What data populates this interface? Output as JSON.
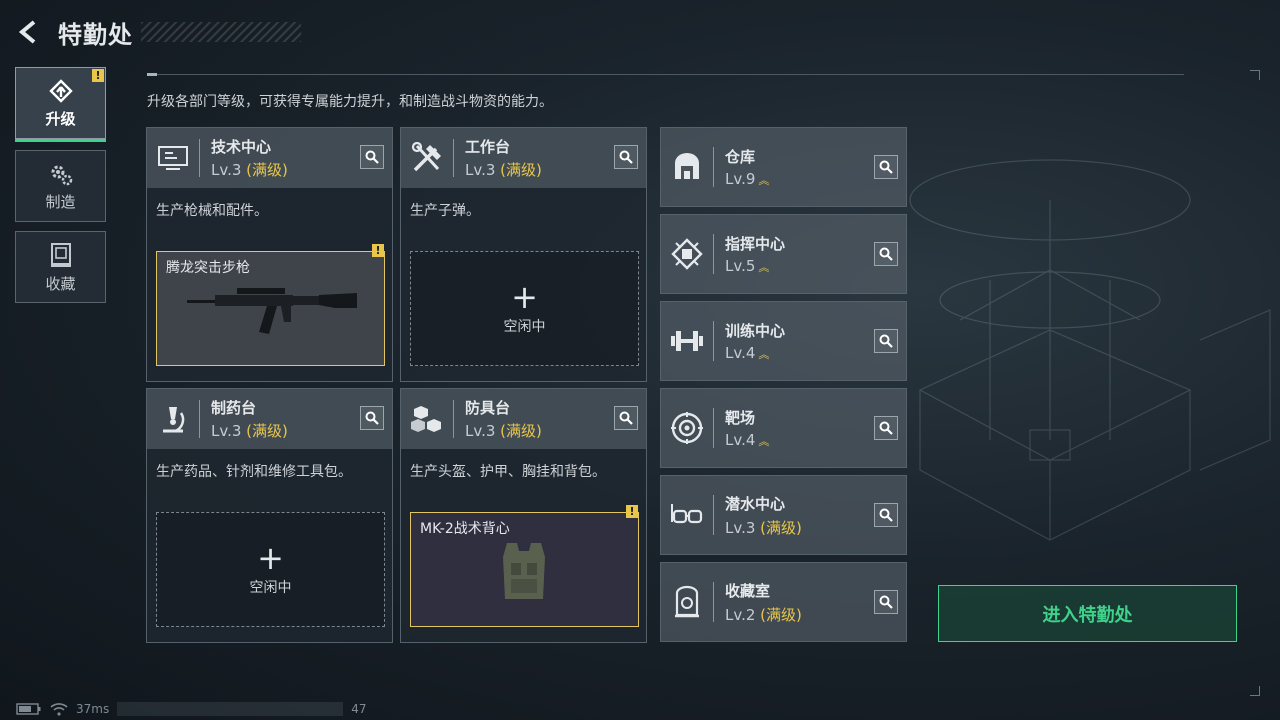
{
  "header": {
    "title": "特勤处"
  },
  "sidebar": {
    "items": [
      {
        "label": "升级",
        "icon": "upgrade-icon",
        "active": true,
        "alert": "!"
      },
      {
        "label": "制造",
        "icon": "gears-icon",
        "active": false
      },
      {
        "label": "收藏",
        "icon": "collection-icon",
        "active": false
      }
    ]
  },
  "description": "升级各部门等级，可获得专属能力提升，和制造战斗物资的能力。",
  "cards": [
    {
      "name": "技术中心",
      "level": "Lv.3",
      "status": "(满级)",
      "icon": "monitor-icon",
      "desc": "生产枪械和配件。",
      "slot": {
        "type": "item",
        "item_name": "腾龙突击步枪",
        "alert": "!",
        "image": "rifle-icon"
      }
    },
    {
      "name": "工作台",
      "level": "Lv.3",
      "status": "(满级)",
      "icon": "tools-icon",
      "desc": "生产子弹。",
      "slot": {
        "type": "idle",
        "plus": "+",
        "text": "空闲中"
      }
    },
    {
      "name": "制药台",
      "level": "Lv.3",
      "status": "(满级)",
      "icon": "microscope-icon",
      "desc": "生产药品、针剂和维修工具包。",
      "slot": {
        "type": "idle",
        "plus": "+",
        "text": "空闲中"
      }
    },
    {
      "name": "防具台",
      "level": "Lv.3",
      "status": "(满级)",
      "icon": "cubes-icon",
      "desc": "生产头盔、护甲、胸挂和背包。",
      "slot": {
        "type": "item",
        "item_name": "MK-2战术背心",
        "alert": "!",
        "image": "vest-icon"
      }
    }
  ],
  "facilities": [
    {
      "name": "仓库",
      "level": "Lv.9",
      "icon": "warehouse-icon",
      "upgradable": true
    },
    {
      "name": "指挥中心",
      "level": "Lv.5",
      "icon": "chip-icon",
      "upgradable": true
    },
    {
      "name": "训练中心",
      "level": "Lv.4",
      "icon": "dumbbell-icon",
      "upgradable": true
    },
    {
      "name": "靶场",
      "level": "Lv.4",
      "icon": "target-icon",
      "upgradable": true
    },
    {
      "name": "潜水中心",
      "level": "Lv.3",
      "status": "(满级)",
      "icon": "goggles-icon",
      "upgradable": false
    },
    {
      "name": "收藏室",
      "level": "Lv.2",
      "status": "(满级)",
      "icon": "vault-icon",
      "upgradable": false
    }
  ],
  "enter_button": "进入特勤处",
  "status_bar": {
    "ping": "37ms",
    "fps": "47"
  },
  "colors": {
    "accent": "#3fd28a",
    "gold": "#e8c64a"
  }
}
